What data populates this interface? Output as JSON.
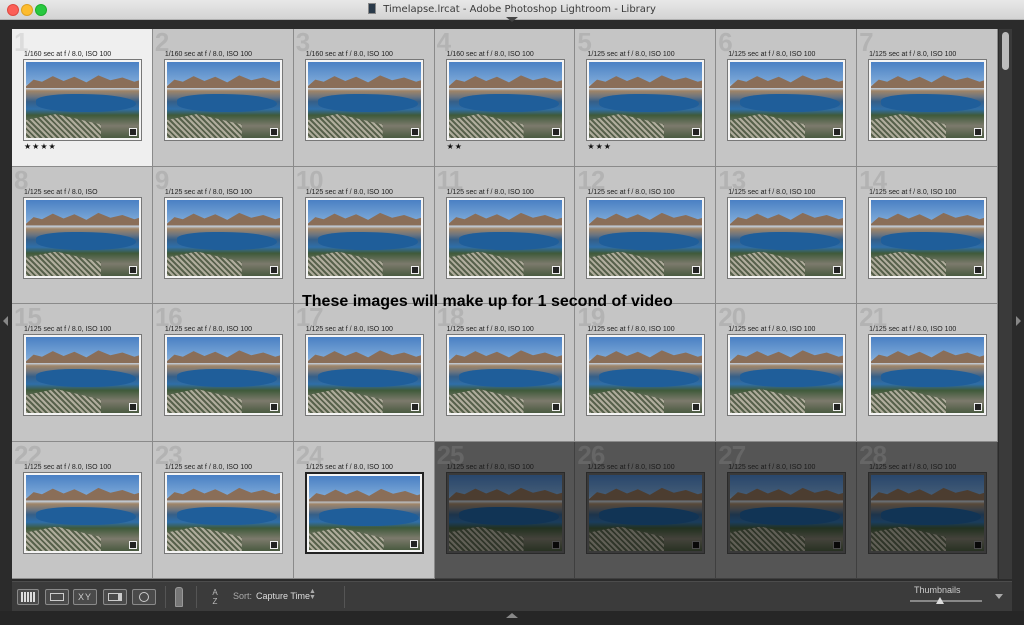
{
  "window": {
    "title": "Timelapse.lrcat - Adobe Photoshop Lightroom - Library"
  },
  "annotation": "These images will make up for 1 second of video",
  "grid": {
    "cells": [
      {
        "num": "1",
        "meta": "1/160 sec at f / 8.0, ISO 100",
        "stars": "★★★★",
        "state": "selected"
      },
      {
        "num": "2",
        "meta": "1/160 sec at f / 8.0, ISO 100",
        "stars": "",
        "state": "normal"
      },
      {
        "num": "3",
        "meta": "1/160 sec at f / 8.0, ISO 100",
        "stars": "",
        "state": "normal"
      },
      {
        "num": "4",
        "meta": "1/160 sec at f / 8.0, ISO 100",
        "stars": "★★",
        "state": "normal"
      },
      {
        "num": "5",
        "meta": "1/125 sec at f / 8.0, ISO 100",
        "stars": "★★★",
        "state": "normal"
      },
      {
        "num": "6",
        "meta": "1/125 sec at f / 8.0, ISO 100",
        "stars": "",
        "state": "normal"
      },
      {
        "num": "7",
        "meta": "1/125 sec at f / 8.0, ISO 100",
        "stars": "",
        "state": "normal"
      },
      {
        "num": "8",
        "meta": "1/125 sec at f / 8.0, ISO",
        "stars": "",
        "state": "normal"
      },
      {
        "num": "9",
        "meta": "1/125 sec at f / 8.0, ISO 100",
        "stars": "",
        "state": "normal"
      },
      {
        "num": "10",
        "meta": "1/125 sec at f / 8.0, ISO 100",
        "stars": "",
        "state": "normal"
      },
      {
        "num": "11",
        "meta": "1/125 sec at f / 8.0, ISO 100",
        "stars": "",
        "state": "normal"
      },
      {
        "num": "12",
        "meta": "1/125 sec at f / 8.0, ISO 100",
        "stars": "",
        "state": "normal"
      },
      {
        "num": "13",
        "meta": "1/125 sec at f / 8.0, ISO 100",
        "stars": "",
        "state": "normal"
      },
      {
        "num": "14",
        "meta": "1/125 sec at f / 8.0, ISO 100",
        "stars": "",
        "state": "normal"
      },
      {
        "num": "15",
        "meta": "1/125 sec at f / 8.0, ISO 100",
        "stars": "",
        "state": "normal"
      },
      {
        "num": "16",
        "meta": "1/125 sec at f / 8.0, ISO 100",
        "stars": "",
        "state": "normal"
      },
      {
        "num": "17",
        "meta": "1/125 sec at f / 8.0, ISO 100",
        "stars": "",
        "state": "normal"
      },
      {
        "num": "18",
        "meta": "1/125 sec at f / 8.0, ISO 100",
        "stars": "",
        "state": "normal"
      },
      {
        "num": "19",
        "meta": "1/125 sec at f / 8.0, ISO 100",
        "stars": "",
        "state": "normal"
      },
      {
        "num": "20",
        "meta": "1/125 sec at f / 8.0, ISO 100",
        "stars": "",
        "state": "normal"
      },
      {
        "num": "21",
        "meta": "1/125 sec at f / 8.0, ISO 100",
        "stars": "",
        "state": "normal"
      },
      {
        "num": "22",
        "meta": "1/125 sec at f / 8.0, ISO 100",
        "stars": "",
        "state": "normal"
      },
      {
        "num": "23",
        "meta": "1/125 sec at f / 8.0, ISO 100",
        "stars": "",
        "state": "normal"
      },
      {
        "num": "24",
        "meta": "1/125 sec at f / 8.0, ISO 100",
        "stars": "",
        "state": "current"
      },
      {
        "num": "25",
        "meta": "1/125 sec at f / 8.0, ISO 100",
        "stars": "",
        "state": "dim"
      },
      {
        "num": "26",
        "meta": "1/125 sec at f / 8.0, ISO 100",
        "stars": "",
        "state": "dim"
      },
      {
        "num": "27",
        "meta": "1/125 sec at f / 8.0, ISO 100",
        "stars": "",
        "state": "dim"
      },
      {
        "num": "28",
        "meta": "1/125 sec at f / 8.0, ISO 100",
        "stars": "",
        "state": "dim"
      }
    ]
  },
  "toolbar": {
    "compare_label": "XY",
    "sort_label": "Sort:",
    "sort_value": "Capture Time",
    "sort_icon_top": "A",
    "sort_icon_bottom": "Z",
    "thumbnails_label": "Thumbnails",
    "thumbnail_size_fraction": 0.42
  },
  "colors": {
    "cell_bg": "#c5c5c5",
    "cell_selected_bg": "#efefef",
    "cell_dim_bg": "#555555",
    "toolbar_bg": "#3b3b3b"
  },
  "icons": {
    "grid_view": "grid-view-icon",
    "loupe_view": "loupe-view-icon",
    "compare_view": "compare-view-icon",
    "survey_view": "survey-view-icon",
    "people_view": "people-view-icon",
    "spray_can": "painter-spray-icon",
    "sort": "sort-az-icon"
  }
}
